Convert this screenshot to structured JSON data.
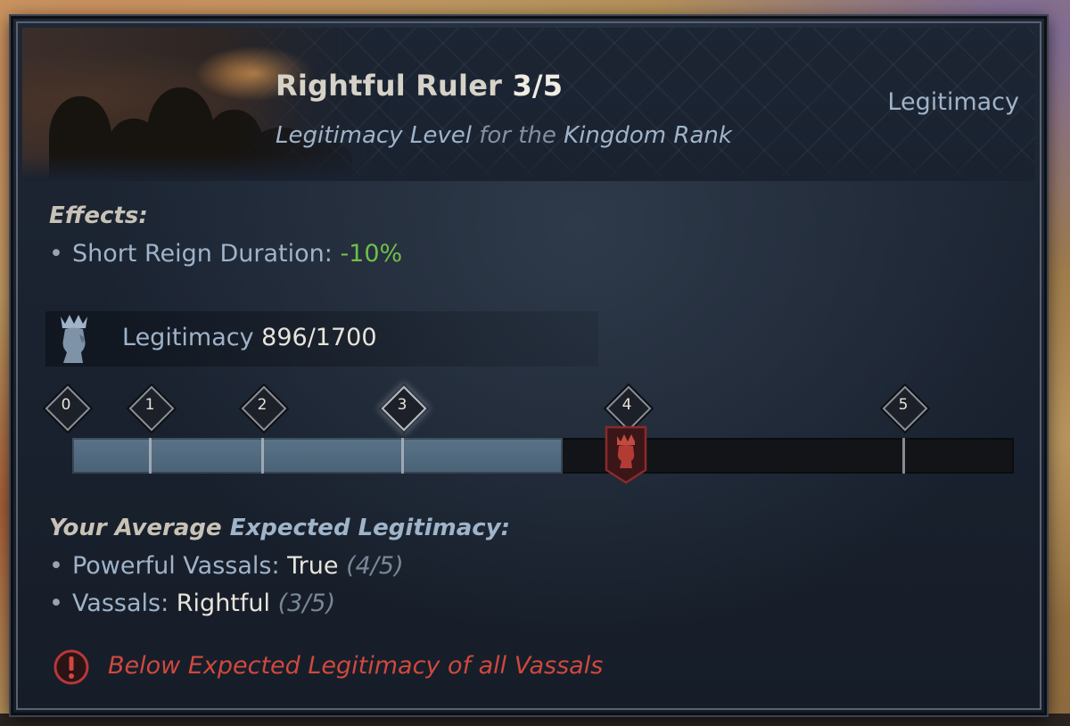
{
  "header": {
    "title": "Rightful Ruler",
    "level": "3/5",
    "subtitle_part1": "Legitimacy Level",
    "subtitle_part2": "for the",
    "subtitle_part3": "Kingdom Rank",
    "category": "Legitimacy"
  },
  "effects": {
    "title": "Effects:",
    "items": [
      {
        "label": "Short Reign Duration:",
        "value": "-10%"
      }
    ]
  },
  "legitimacy": {
    "label": "Legitimacy",
    "value": "896/1700",
    "current": 896,
    "max": 1700,
    "icon": "crowned-head-icon"
  },
  "progress": {
    "levels": [
      "0",
      "1",
      "2",
      "3",
      "4",
      "5"
    ],
    "current_level": "3",
    "badge_icon": "crowned-head-badge-icon"
  },
  "expected": {
    "title_part1": "Your Average",
    "title_part2": "Expected Legitimacy:",
    "items": [
      {
        "label": "Powerful Vassals:",
        "value": "True",
        "detail": "(4/5)"
      },
      {
        "label": "Vassals:",
        "value": "Rightful",
        "detail": "(3/5)"
      }
    ]
  },
  "warning": {
    "icon": "exclamation-circle-icon",
    "text": "Below Expected Legitimacy of all Vassals"
  },
  "colors": {
    "accent_blue": "#9fb3c9",
    "positive_green": "#6fbf4a",
    "warning_red": "#d0483e",
    "bar_fill": "#5b7388"
  }
}
